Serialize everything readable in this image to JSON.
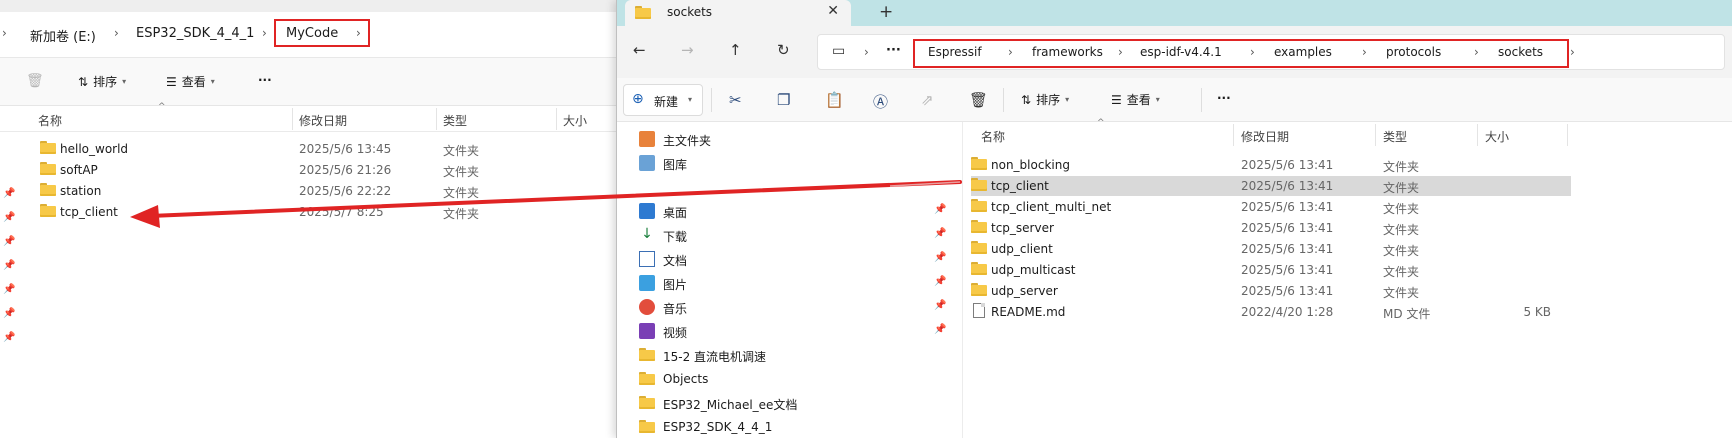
{
  "left_window": {
    "breadcrumb": [
      "新加卷 (E:)",
      "ESP32_SDK_4_4_1",
      "MyCode"
    ],
    "toolbar": {
      "sort_label": "排序",
      "view_label": "查看",
      "more_label": "···"
    },
    "columns": {
      "name": "名称",
      "date": "修改日期",
      "type": "类型",
      "size": "大小"
    },
    "files": [
      {
        "name": "hello_world",
        "date": "2025/5/6 13:45",
        "type": "文件夹"
      },
      {
        "name": "softAP",
        "date": "2025/5/6 21:26",
        "type": "文件夹"
      },
      {
        "name": "station",
        "date": "2025/5/6 22:22",
        "type": "文件夹"
      },
      {
        "name": "tcp_client",
        "date": "2025/5/7 8:25",
        "type": "文件夹"
      }
    ]
  },
  "right_window": {
    "tab": {
      "title": "sockets",
      "close": "✕",
      "new_tab": "+"
    },
    "breadcrumb": [
      "Espressif",
      "frameworks",
      "esp-idf-v4.4.1",
      "examples",
      "protocols",
      "sockets"
    ],
    "toolbar": {
      "new_label": "新建",
      "sort_label": "排序",
      "view_label": "查看",
      "more_label": "···"
    },
    "columns": {
      "name": "名称",
      "date": "修改日期",
      "type": "类型",
      "size": "大小"
    },
    "nav_items": [
      {
        "label": "主文件夹",
        "icon": "home-icon"
      },
      {
        "label": "图库",
        "icon": "gallery-icon"
      },
      {
        "label": "桌面",
        "icon": "desktop-icon",
        "pinned": true
      },
      {
        "label": "下载",
        "icon": "download-icon",
        "pinned": true
      },
      {
        "label": "文档",
        "icon": "documents-icon",
        "pinned": true
      },
      {
        "label": "图片",
        "icon": "pictures-icon",
        "pinned": true
      },
      {
        "label": "音乐",
        "icon": "music-icon",
        "pinned": true
      },
      {
        "label": "视频",
        "icon": "videos-icon",
        "pinned": true
      },
      {
        "label": "15-2 直流电机调速",
        "icon": "folder-icon"
      },
      {
        "label": "Objects",
        "icon": "folder-icon"
      },
      {
        "label": "ESP32_Michael_ee文档",
        "icon": "folder-icon"
      },
      {
        "label": "ESP32_SDK_4_4_1",
        "icon": "folder-icon"
      }
    ],
    "files": [
      {
        "name": "non_blocking",
        "date": "2025/5/6 13:41",
        "type": "文件夹",
        "size": ""
      },
      {
        "name": "tcp_client",
        "date": "2025/5/6 13:41",
        "type": "文件夹",
        "size": "",
        "selected": true
      },
      {
        "name": "tcp_client_multi_net",
        "date": "2025/5/6 13:41",
        "type": "文件夹",
        "size": ""
      },
      {
        "name": "tcp_server",
        "date": "2025/5/6 13:41",
        "type": "文件夹",
        "size": ""
      },
      {
        "name": "udp_client",
        "date": "2025/5/6 13:41",
        "type": "文件夹",
        "size": ""
      },
      {
        "name": "udp_multicast",
        "date": "2025/5/6 13:41",
        "type": "文件夹",
        "size": ""
      },
      {
        "name": "udp_server",
        "date": "2025/5/6 13:41",
        "type": "文件夹",
        "size": ""
      },
      {
        "name": "README.md",
        "date": "2022/4/20 1:28",
        "type": "MD 文件",
        "size": "5 KB",
        "file": true
      }
    ]
  },
  "colors": {
    "annotation_red": "#e02424",
    "tab_bar": "#bfe3e6",
    "folder": "#f7c948"
  }
}
